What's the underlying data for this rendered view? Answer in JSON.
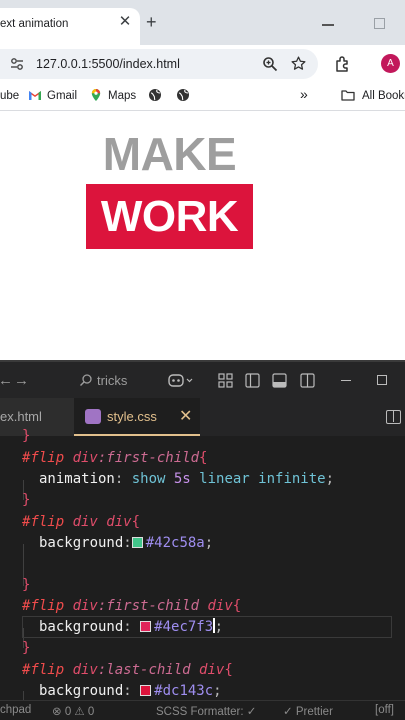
{
  "browser": {
    "tab_title": "ext animation",
    "tab_close": "✕",
    "new_tab": "+",
    "url": "127.0.0.1:5500/index.html",
    "avatar_initial": "A",
    "bookmarks": [
      "ube",
      "Gmail",
      "Maps"
    ],
    "bookmarks_overflow": "»",
    "all_bookmarks": "All Bookm"
  },
  "page": {
    "headline_top": "MAKE",
    "headline_bottom": "WORK",
    "colors": {
      "gray_text": "#9e9e9e",
      "box_red": "#dc143c"
    }
  },
  "vscode": {
    "nav_back": "←",
    "nav_forward": "→",
    "search_text": "tricks",
    "tabs": [
      {
        "label": "ex.html"
      },
      {
        "label": "style.css",
        "close": "✕"
      }
    ],
    "code": {
      "l0": "}",
      "l1_sel": "#flip ",
      "l1_tag": "div",
      "l1_pseudo": ":first-child",
      "l1_brace": "{",
      "l2_prop": "animation",
      "l2_colon": ": ",
      "l2_val1": "show ",
      "l2_num": "5s",
      "l2_val2": " linear infinite",
      "l2_semi": ";",
      "l3": "}",
      "l4_sel": "#flip ",
      "l4_tag": "div div",
      "l4_brace": "{",
      "l5_prop": "background",
      "l5_colon": ":",
      "l5_hex": "#42c58a",
      "l5_semi": ";",
      "l7": "}",
      "l8_sel": "#flip ",
      "l8_tag": "div",
      "l8_pseudo": ":first-child",
      "l8_tag2": " div",
      "l8_brace": "{",
      "l9_prop": "background",
      "l9_colon": ": ",
      "l9_hex": "#4ec7f3",
      "l9_semi": ";",
      "l10": "}",
      "l11_sel": "#flip ",
      "l11_tag": "div",
      "l11_pseudo": ":last-child",
      "l11_tag2": " div",
      "l11_brace": "{",
      "l12_prop": "background",
      "l12_colon": ": ",
      "l12_hex": "#dc143c",
      "l12_semi": ";"
    },
    "swatches": {
      "green": "#42c58a",
      "pink": "#e0255a",
      "red": "#dc143c"
    },
    "status": {
      "left": "chpad",
      "problems": "⊗ 0 ⚠ 0",
      "formatter": "SCSS Formatter: ✓",
      "prettier": "✓ Prettier",
      "off": "[off]"
    }
  }
}
